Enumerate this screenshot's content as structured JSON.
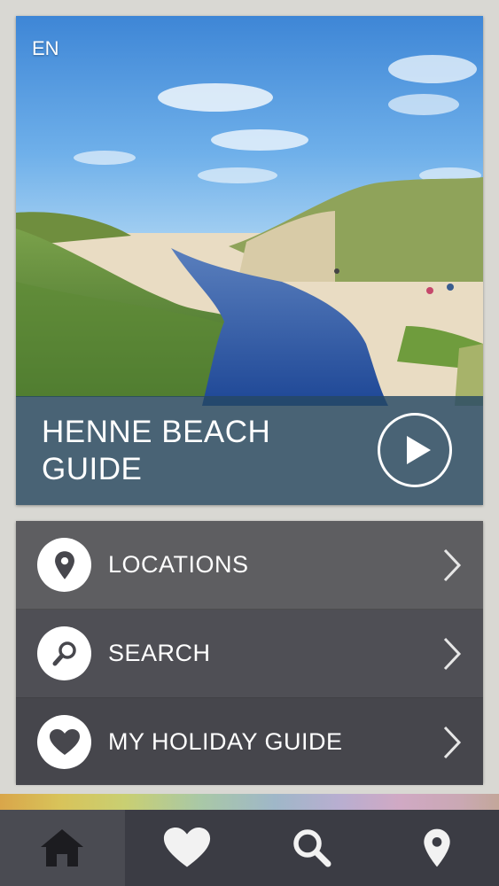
{
  "hero": {
    "language": "EN",
    "title_line1": "HENNE BEACH",
    "title_line2": "GUIDE",
    "play_icon": "play-icon"
  },
  "menu": {
    "items": [
      {
        "label": "LOCATIONS",
        "icon": "map-pin-icon"
      },
      {
        "label": "SEARCH",
        "icon": "search-icon"
      },
      {
        "label": "MY HOLIDAY GUIDE",
        "icon": "heart-icon"
      }
    ]
  },
  "tabbar": {
    "tabs": [
      {
        "icon": "home-icon",
        "active": true
      },
      {
        "icon": "heart-icon",
        "active": false
      },
      {
        "icon": "search-icon",
        "active": false
      },
      {
        "icon": "map-pin-icon",
        "active": false
      }
    ]
  },
  "colors": {
    "title_band": "#264864",
    "menu_bg": "#4f4f55",
    "tabbar_bg": "#3b3c44",
    "page_bg": "#d9d8d3"
  }
}
